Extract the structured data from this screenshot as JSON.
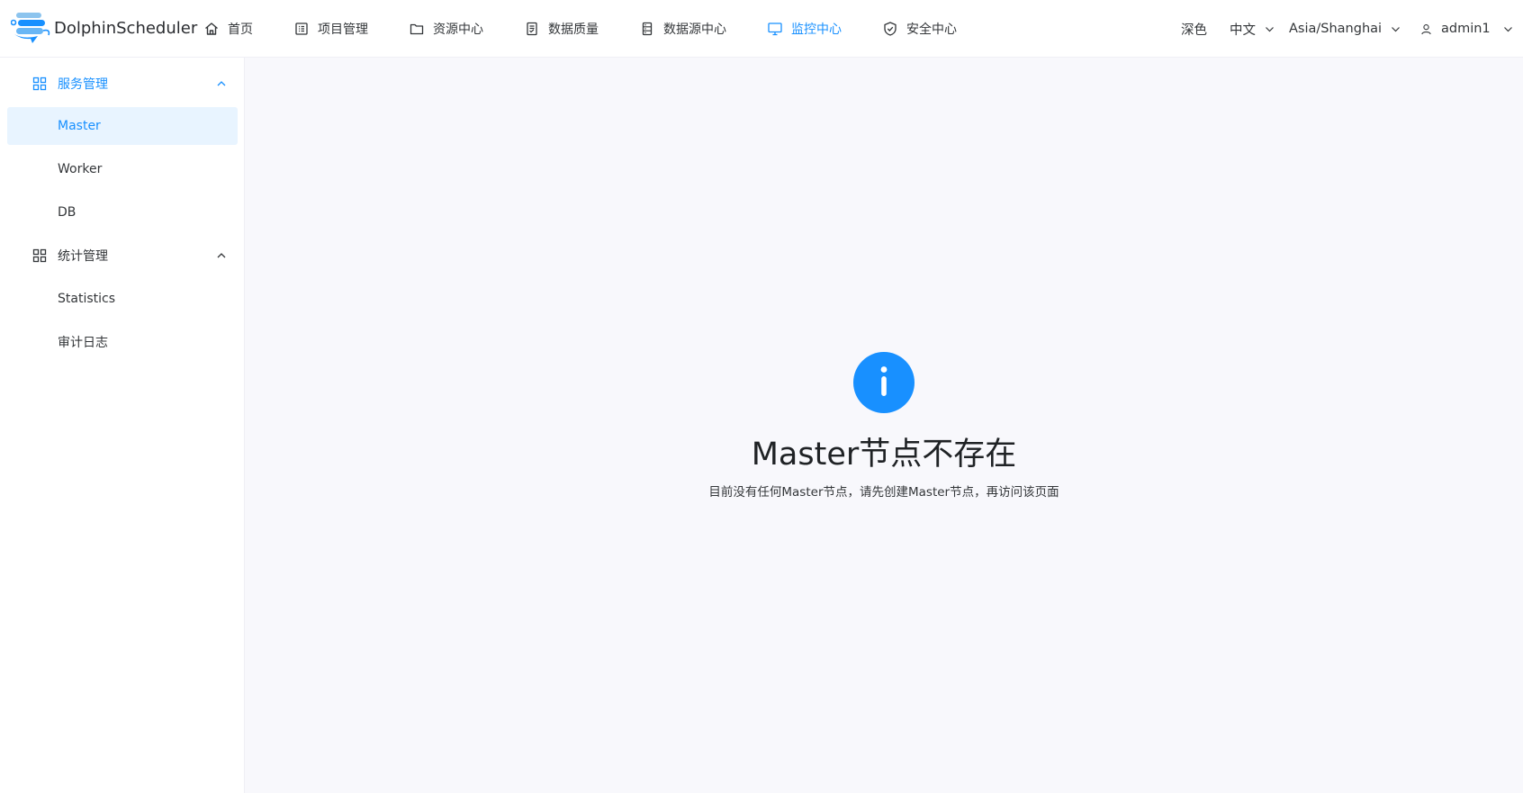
{
  "header": {
    "logo_text": "DolphinScheduler",
    "nav": [
      {
        "label": "首页",
        "icon": "home-icon"
      },
      {
        "label": "项目管理",
        "icon": "project-list-icon"
      },
      {
        "label": "资源中心",
        "icon": "folder-icon"
      },
      {
        "label": "数据质量",
        "icon": "data-quality-icon"
      },
      {
        "label": "数据源中心",
        "icon": "datasource-icon"
      },
      {
        "label": "监控中心",
        "icon": "monitor-icon"
      },
      {
        "label": "安全中心",
        "icon": "shield-check-icon"
      }
    ],
    "active_nav": "监控中心",
    "theme_label": "深色",
    "language": "中文",
    "timezone": "Asia/Shanghai",
    "user": "admin1"
  },
  "sidebar": {
    "groups": [
      {
        "label": "服务管理",
        "icon": "grid-icon",
        "items": [
          "Master",
          "Worker",
          "DB"
        ]
      },
      {
        "label": "统计管理",
        "icon": "grid-icon",
        "items": [
          "Statistics",
          "审计日志"
        ]
      }
    ],
    "active_item": "Master"
  },
  "main": {
    "title": "Master节点不存在",
    "description": "目前没有任何Master节点，请先创建Master节点，再访问该页面"
  },
  "colors": {
    "accent": "#1890ff",
    "active_bg": "#e8f4ff",
    "content_bg": "#f8f8fc"
  }
}
